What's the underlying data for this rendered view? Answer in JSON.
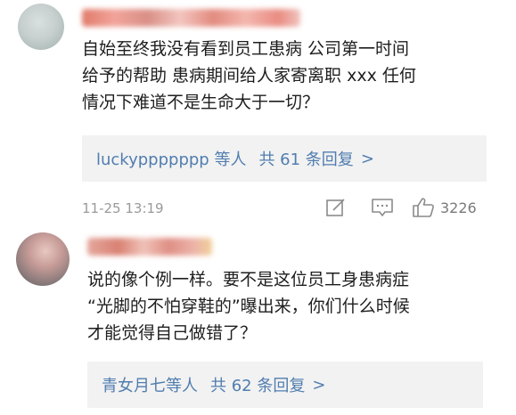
{
  "comments": [
    {
      "text_lines": [
        "自始至终我没有看到员工患病 公司第一时间",
        "给予的帮助 患病期间给人家寄离职 xxx 任何",
        "情况下难道不是生命大于一切？"
      ],
      "reply": {
        "users": "luckyppppppp 等人",
        "count": "共 61 条回复",
        "chevron": ">"
      },
      "timestamp": "11-25 13:19",
      "likes": "3226"
    },
    {
      "text_lines": [
        "说的像个例一样。要不是这位员工身患病症",
        "“光脚的不怕穿鞋的”曝出来，你们什么时候",
        "才能觉得自己做错了？"
      ],
      "reply": {
        "users": "青女月七等人",
        "count": "共 62 条回复",
        "chevron": ">"
      }
    }
  ],
  "icons": {
    "edit": "edit-icon",
    "comment": "comment-icon",
    "like": "thumbs-up-icon"
  },
  "colors": {
    "link": "#507daf",
    "reply_bg": "#f2f2f2",
    "meta": "#9a9a9a"
  }
}
